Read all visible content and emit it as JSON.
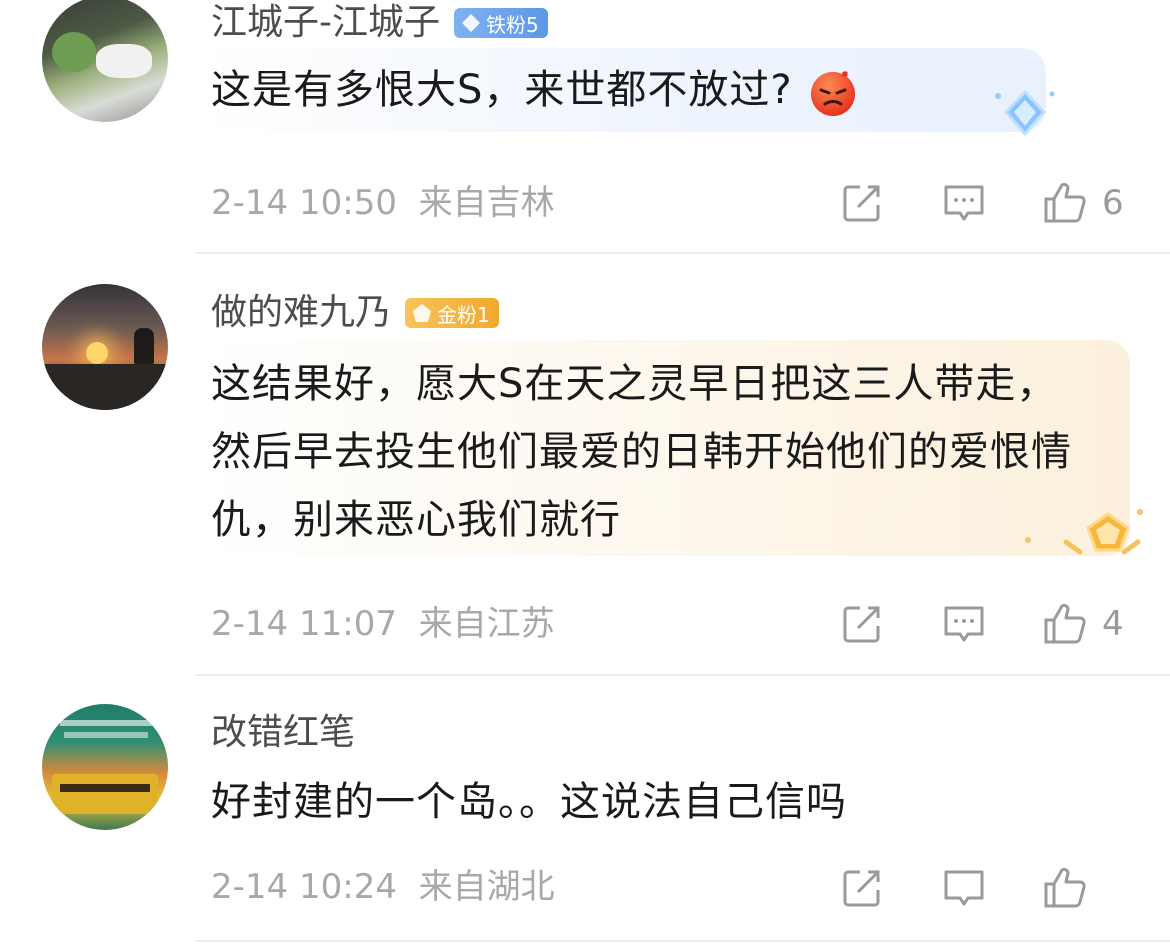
{
  "comments": [
    {
      "username": "江城子-江城子",
      "badge": "铁粉5",
      "badge_type": "iron",
      "text": "这是有多恨大S，来世都不放过?",
      "emoji": "angry-face-emoji",
      "time": "2-14 10:50",
      "location": "来自吉林",
      "likes": "6",
      "bubble_color": "#eef4fd"
    },
    {
      "username": "做的难九乃",
      "badge": "金粉1",
      "badge_type": "gold",
      "text": "这结果好，愿大S在天之灵早日把这三人带走，然后早去投生他们最爱的日韩开始他们的爱恨情仇，别来恶心我们就行",
      "time": "2-14 11:07",
      "location": "来自江苏",
      "likes": "4",
      "bubble_color": "#fdf5e6"
    },
    {
      "username": "改错红笔",
      "text": "好封建的一个岛。。这说法自己信吗",
      "time": "2-14 10:24",
      "location": "来自湖北"
    }
  ],
  "icons": {
    "share": "share-icon",
    "comment": "comment-icon",
    "like": "thumbs-up-icon"
  }
}
